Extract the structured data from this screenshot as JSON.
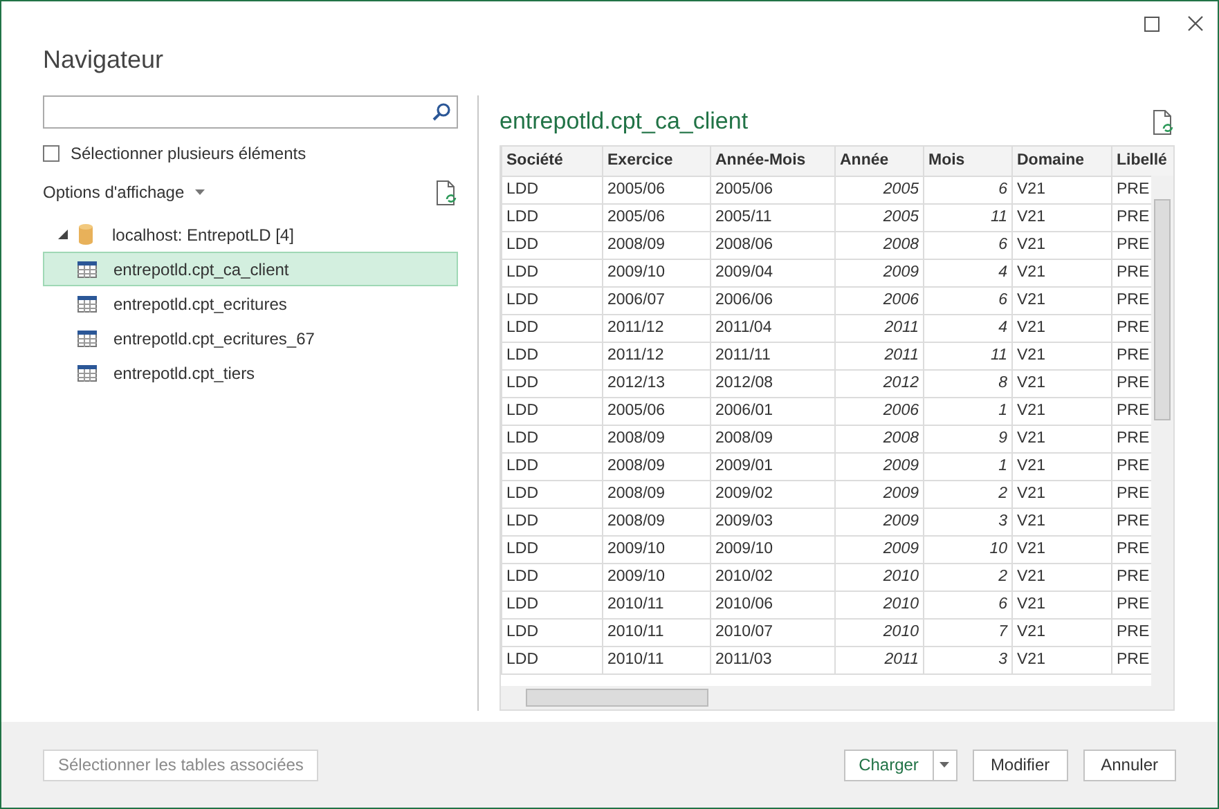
{
  "window": {
    "title": "Navigateur"
  },
  "multi_select": {
    "label": "Sélectionner plusieurs éléments",
    "checked": false
  },
  "display_options": {
    "label": "Options d'affichage"
  },
  "tree": [
    {
      "label": "localhost: EntrepotLD [4]",
      "kind": "database",
      "expanded": true,
      "selected": false,
      "children": [
        {
          "label": "entrepotld.cpt_ca_client",
          "kind": "table",
          "selected": true
        },
        {
          "label": "entrepotld.cpt_ecritures",
          "kind": "table",
          "selected": false
        },
        {
          "label": "entrepotld.cpt_ecritures_67",
          "kind": "table",
          "selected": false
        },
        {
          "label": "entrepotld.cpt_tiers",
          "kind": "table",
          "selected": false
        }
      ]
    }
  ],
  "preview": {
    "title": "entrepotld.cpt_ca_client",
    "columns": [
      "Société",
      "Exercice",
      "Année-Mois",
      "Année",
      "Mois",
      "Domaine",
      "Libellé"
    ],
    "rows": [
      [
        "LDD",
        "2005/06",
        "2005/06",
        "2005",
        "6",
        "V21",
        "PRE"
      ],
      [
        "LDD",
        "2005/06",
        "2005/11",
        "2005",
        "11",
        "V21",
        "PRE"
      ],
      [
        "LDD",
        "2008/09",
        "2008/06",
        "2008",
        "6",
        "V21",
        "PRE"
      ],
      [
        "LDD",
        "2009/10",
        "2009/04",
        "2009",
        "4",
        "V21",
        "PRE"
      ],
      [
        "LDD",
        "2006/07",
        "2006/06",
        "2006",
        "6",
        "V21",
        "PRE"
      ],
      [
        "LDD",
        "2011/12",
        "2011/04",
        "2011",
        "4",
        "V21",
        "PRE"
      ],
      [
        "LDD",
        "2011/12",
        "2011/11",
        "2011",
        "11",
        "V21",
        "PRE"
      ],
      [
        "LDD",
        "2012/13",
        "2012/08",
        "2012",
        "8",
        "V21",
        "PRE"
      ],
      [
        "LDD",
        "2005/06",
        "2006/01",
        "2006",
        "1",
        "V21",
        "PRE"
      ],
      [
        "LDD",
        "2008/09",
        "2008/09",
        "2008",
        "9",
        "V21",
        "PRE"
      ],
      [
        "LDD",
        "2008/09",
        "2009/01",
        "2009",
        "1",
        "V21",
        "PRE"
      ],
      [
        "LDD",
        "2008/09",
        "2009/02",
        "2009",
        "2",
        "V21",
        "PRE"
      ],
      [
        "LDD",
        "2008/09",
        "2009/03",
        "2009",
        "3",
        "V21",
        "PRE"
      ],
      [
        "LDD",
        "2009/10",
        "2009/10",
        "2009",
        "10",
        "V21",
        "PRE"
      ],
      [
        "LDD",
        "2009/10",
        "2010/02",
        "2010",
        "2",
        "V21",
        "PRE"
      ],
      [
        "LDD",
        "2010/11",
        "2010/06",
        "2010",
        "6",
        "V21",
        "PRE"
      ],
      [
        "LDD",
        "2010/11",
        "2010/07",
        "2010",
        "7",
        "V21",
        "PRE"
      ],
      [
        "LDD",
        "2010/11",
        "2011/03",
        "2011",
        "3",
        "V21",
        "PRE"
      ]
    ]
  },
  "footer": {
    "related_button": {
      "label": "Sélectionner les tables associées",
      "disabled": true
    },
    "buttons": [
      {
        "label": "Charger",
        "kind": "split"
      },
      {
        "label": "Modifier",
        "kind": "plain"
      },
      {
        "label": "Annuler",
        "kind": "plain"
      }
    ]
  }
}
